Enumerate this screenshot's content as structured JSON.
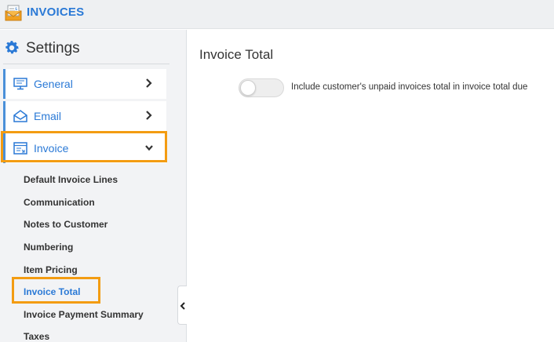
{
  "header": {
    "title": "INVOICES"
  },
  "sidebar": {
    "title": "Settings",
    "items": [
      {
        "label": "General"
      },
      {
        "label": "Email"
      },
      {
        "label": "Invoice"
      }
    ],
    "subitems": [
      "Default Invoice Lines",
      "Communication",
      "Notes to Customer",
      "Numbering",
      "Item Pricing",
      "Invoice Total",
      "Invoice Payment Summary",
      "Taxes"
    ]
  },
  "main": {
    "title": "Invoice Total",
    "toggle": {
      "label": "Include customer's unpaid invoices total in invoice total due",
      "on": false
    }
  },
  "colors": {
    "accent": "#2a79d6",
    "highlight": "#f39c12"
  }
}
